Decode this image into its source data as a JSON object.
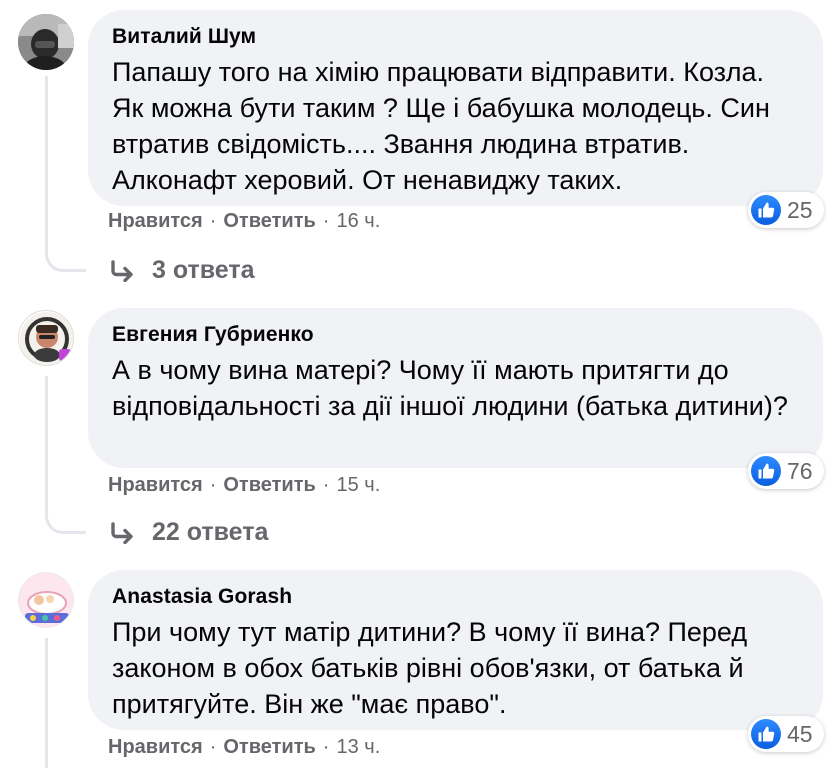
{
  "comments": [
    {
      "author": "Виталий Шум",
      "text": "Папашу того на хімію працювати відправити. Козла. Як можна бути таким ? Ще і бабушка молодець. Син втратив свідомість.... Звання людина втратив. Алконафт херовий. От ненавиджу таких.",
      "reaction_count": "25",
      "like_label": "Нравится",
      "reply_label": "Ответить",
      "time": "16 ч.",
      "replies_label": "3 ответа"
    },
    {
      "author": "Евгения Губриенко",
      "text": "А в чому вина матері? Чому її мають притягти до відповідальності за дії іншої людини (батька дитини)?",
      "reaction_count": "76",
      "like_label": "Нравится",
      "reply_label": "Ответить",
      "time": "15 ч.",
      "replies_label": "22 ответа"
    },
    {
      "author": "Anastasia Gorash",
      "text": "При чому тут матір дитини? В чому її вина? Перед законом в обох батьків рівні обов'язки, от батька й притягуйте. Він же \"має право\".",
      "reaction_count": "45",
      "like_label": "Нравится",
      "reply_label": "Ответить",
      "time": "13 ч."
    }
  ],
  "separator": "·",
  "icons": {
    "reaction": "like-icon",
    "replies": "reply-arrow-icon"
  },
  "colors": {
    "bubble": "#f0f2f5",
    "meta_text": "#65676b",
    "like_blue": "#1877f2"
  }
}
